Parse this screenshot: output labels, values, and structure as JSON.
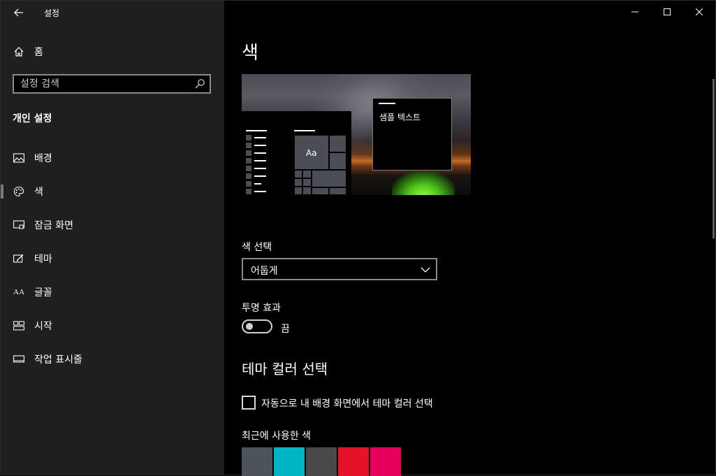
{
  "window": {
    "title": "설정",
    "controls": [
      "minimize-icon",
      "maximize-icon",
      "close-icon"
    ]
  },
  "sidebar": {
    "home_label": "홈",
    "search_placeholder": "설정 검색",
    "section_title": "개인 설정",
    "items": [
      {
        "label": "배경",
        "icon": "picture-icon"
      },
      {
        "label": "색",
        "icon": "palette-icon",
        "active": true
      },
      {
        "label": "잠금 화면",
        "icon": "lock-screen-icon"
      },
      {
        "label": "테마",
        "icon": "theme-icon"
      },
      {
        "label": "글꼴",
        "icon": "font-icon"
      },
      {
        "label": "시작",
        "icon": "start-icon"
      },
      {
        "label": "작업 표시줄",
        "icon": "taskbar-icon"
      }
    ],
    "font_icon_text": "AA"
  },
  "main": {
    "title": "색",
    "preview": {
      "tile_label": "Aa",
      "sample_text": "샘플 텍스트"
    },
    "choose_color": {
      "label": "색 선택",
      "selected": "어둡게"
    },
    "transparency": {
      "label": "투명 효과",
      "state": "끔",
      "on": false
    },
    "accent_heading": "테마 컬러 선택",
    "auto_accent": {
      "label": "자동으로 내 배경 화면에서 테마 컬러 선택",
      "checked": false
    },
    "recent_colors": {
      "label": "최근에 사용한 색",
      "colors": [
        "#4c535b",
        "#00b6c4",
        "#4a4848",
        "#e41327",
        "#e6005c"
      ]
    }
  }
}
